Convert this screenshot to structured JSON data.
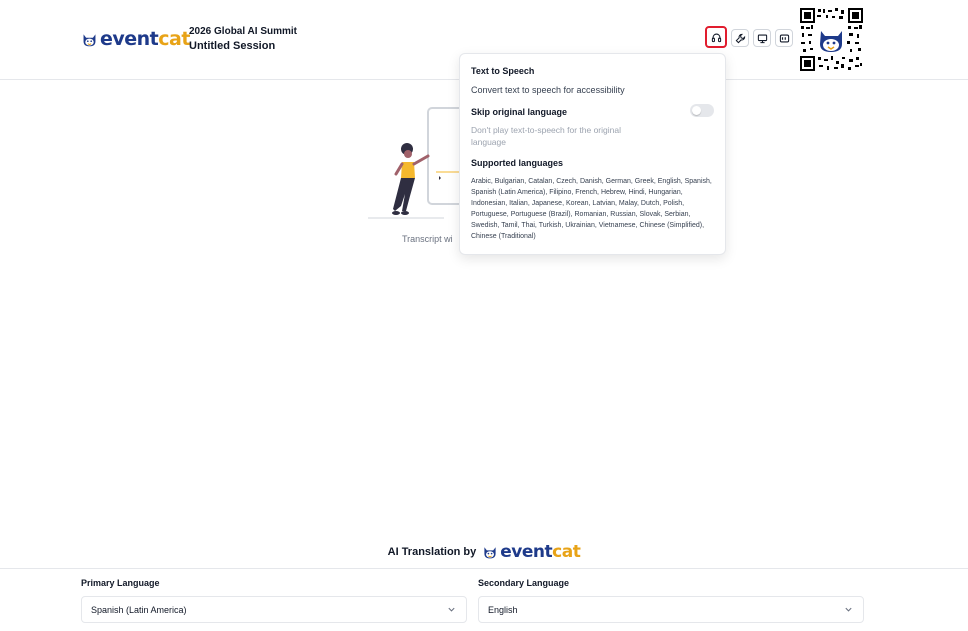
{
  "brand": {
    "part1": "event",
    "part2": "cat",
    "color_primary": "#1e3a8a",
    "color_accent": "#e8a317"
  },
  "header": {
    "event_name": "2026 Global AI Summit",
    "session_name": "Untitled Session",
    "tools": [
      {
        "name": "headphones-icon",
        "active": true
      },
      {
        "name": "wrench-icon",
        "active": false
      },
      {
        "name": "monitor-icon",
        "active": false
      },
      {
        "name": "caption-icon",
        "active": false
      }
    ]
  },
  "empty_state": {
    "hint": "Transcript wi"
  },
  "tts_popover": {
    "title": "Text to Speech",
    "description": "Convert text to speech for accessibility",
    "skip_label": "Skip original language",
    "skip_enabled": false,
    "skip_description": "Don't play text-to-speech for the original language",
    "languages_title": "Supported languages",
    "languages": "Arabic, Bulgarian, Catalan, Czech, Danish, German, Greek, English, Spanish, Spanish (Latin America), Filipino, French, Hebrew, Hindi, Hungarian, Indonesian, Italian, Japanese, Korean, Latvian, Malay, Dutch, Polish, Portuguese, Portuguese (Brazil), Romanian, Russian, Slovak, Serbian, Swedish, Tamil, Thai, Turkish, Ukrainian, Vietnamese, Chinese (Simplified), Chinese (Traditional)"
  },
  "footer": {
    "powered_label": "AI Translation by",
    "primary_label": "Primary Language",
    "primary_value": "Spanish (Latin America)",
    "secondary_label": "Secondary Language",
    "secondary_value": "English"
  },
  "colors": {
    "active_outline": "#e11d2e",
    "border": "#e5e7eb",
    "figure_shirt": "#f5b82e",
    "figure_body": "#2f2e41"
  }
}
